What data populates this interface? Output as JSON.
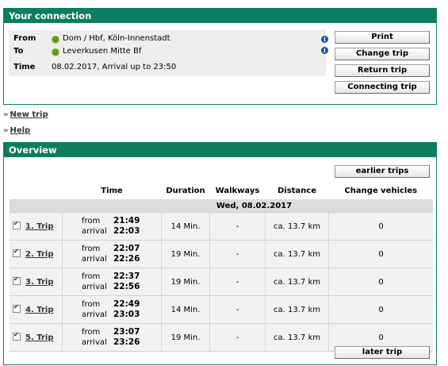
{
  "connection": {
    "title": "Your connection",
    "from_label": "From",
    "from_value": "Dom / Hbf, Köln-Innenstadt",
    "to_label": "To",
    "to_value": "Leverkusen Mitte Bf",
    "time_label": "Time",
    "time_value": "08.02.2017, Arrival up to 23:50",
    "tram_icon_glyph": "Ⓤ",
    "info_glyph": "i",
    "buttons": {
      "print": "Print",
      "change": "Change trip",
      "return": "Return trip",
      "connecting": "Connecting trip"
    }
  },
  "links": {
    "new_trip": "New trip",
    "help": "Help",
    "arrow": "»"
  },
  "overview": {
    "title": "Overview",
    "earlier": "earlier trips",
    "later": "later trip",
    "columns": {
      "time": "Time",
      "duration": "Duration",
      "walkways": "Walkways",
      "distance": "Distance",
      "change": "Change vehicles"
    },
    "date": "Wed, 08.02.2017",
    "from_label": "from",
    "arrival_label": "arrival",
    "trips": [
      {
        "label": "1. Trip",
        "from": "21:49",
        "arrival": "22:03",
        "duration": "14 Min.",
        "walkways": "-",
        "distance": "ca. 13.7 km",
        "changes": "0"
      },
      {
        "label": "2. Trip",
        "from": "22:07",
        "arrival": "22:26",
        "duration": "19 Min.",
        "walkways": "-",
        "distance": "ca. 13.7 km",
        "changes": "0"
      },
      {
        "label": "3. Trip",
        "from": "22:37",
        "arrival": "22:56",
        "duration": "19 Min.",
        "walkways": "-",
        "distance": "ca. 13.7 km",
        "changes": "0"
      },
      {
        "label": "4. Trip",
        "from": "22:49",
        "arrival": "23:03",
        "duration": "14 Min.",
        "walkways": "-",
        "distance": "ca. 13.7 km",
        "changes": "0"
      },
      {
        "label": "5. Trip",
        "from": "23:07",
        "arrival": "23:26",
        "duration": "19 Min.",
        "walkways": "-",
        "distance": "ca. 13.7 km",
        "changes": "0"
      }
    ]
  }
}
